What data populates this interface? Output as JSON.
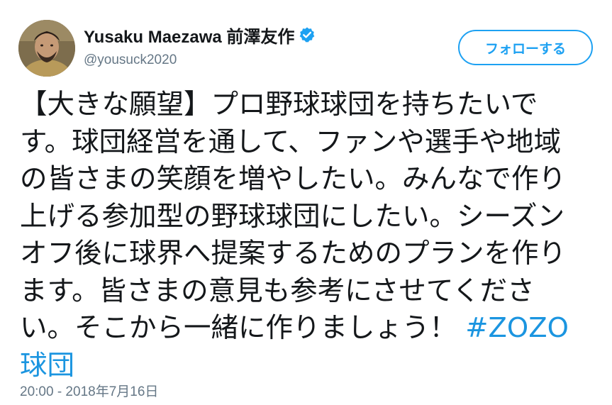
{
  "user": {
    "display_name": "Yusaku Maezawa 前澤友作",
    "handle": "@yousuck2020",
    "verified_icon": "verified-badge-icon",
    "avatar_icon": "avatar-photo"
  },
  "follow_button": {
    "label": "フォローする"
  },
  "tweet": {
    "lines": [
      "【大きな願望】プロ野球球団を持ちたいで",
      "す。球団経営を通して、ファンや選手や地域",
      "の皆さまの笑顔を増やしたい。みんなで作り",
      "上げる参加型の野球球団にしたい。シーズン",
      "オフ後に球界へ提案するためのプランを作り",
      "ます。皆さまの意見も参考にさせてくださ"
    ],
    "line7_text": "い。そこから一緒に作りましょう！",
    "hashtag_part1": "#ZOZO",
    "hashtag_part2": "球団",
    "timestamp": "20:00 - 2018年7月16日"
  },
  "colors": {
    "accent": "#1da1f2",
    "hashtag": "#1b95e0",
    "secondary_text": "#657786",
    "primary_text": "#14171a"
  }
}
